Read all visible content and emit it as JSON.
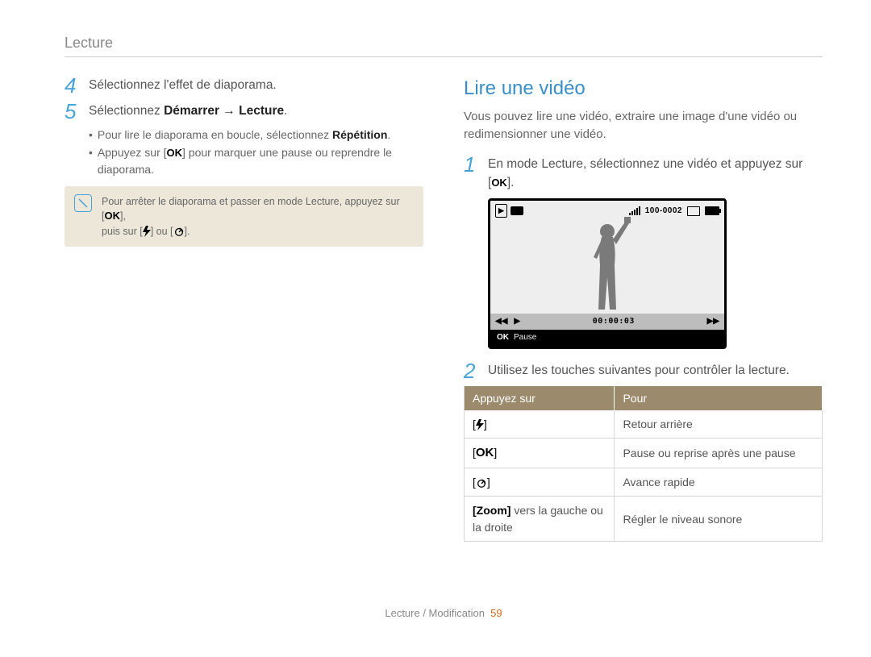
{
  "header": "Lecture",
  "left": {
    "step4": "Sélectionnez l'effet de diaporama.",
    "step5_pre": "Sélectionnez ",
    "step5_bold": "Démarrer → Lecture",
    "step5_post": ".",
    "bullet1_pre": "Pour lire le diaporama en boucle, sélectionnez ",
    "bullet1_bold": "Répétition",
    "bullet1_post": ".",
    "bullet2_pre": "Appuyez sur [",
    "bullet2_post": "] pour marquer une pause ou reprendre le diaporama.",
    "note_line1_pre": "Pour arrêter le diaporama et passer en mode Lecture, appuyez sur [",
    "note_line1_post": "],",
    "note_line2_pre": "puis sur [",
    "note_line2_mid": "] ou [",
    "note_line2_post": "]."
  },
  "right": {
    "heading": "Lire une vidéo",
    "intro": "Vous pouvez lire une vidéo, extraire une image d'une vidéo ou redimensionner une vidéo.",
    "step1_pre": "En mode Lecture, sélectionnez une vidéo et appuyez sur [",
    "step1_post": "].",
    "lcd": {
      "topleft_play": "▶",
      "file_index": "100-0002",
      "time": "00:00:03",
      "ok": "OK",
      "pause_label": "Pause"
    },
    "step2": "Utilisez les touches suivantes pour contrôler la lecture.",
    "table": {
      "head": [
        "Appuyez sur",
        "Pour"
      ],
      "rows": [
        {
          "key_type": "flash",
          "action": "Retour arrière"
        },
        {
          "key_type": "ok",
          "action": "Pause ou reprise après une pause"
        },
        {
          "key_type": "timer",
          "action": "Avance rapide"
        },
        {
          "key_type": "zoom",
          "zoom_bold": "[Zoom]",
          "zoom_text": " vers la gauche ou la droite",
          "action": "Régler le niveau sonore"
        }
      ]
    }
  },
  "footer": {
    "text": "Lecture / Modification",
    "page": "59"
  },
  "labels": {
    "ok": "OK"
  }
}
